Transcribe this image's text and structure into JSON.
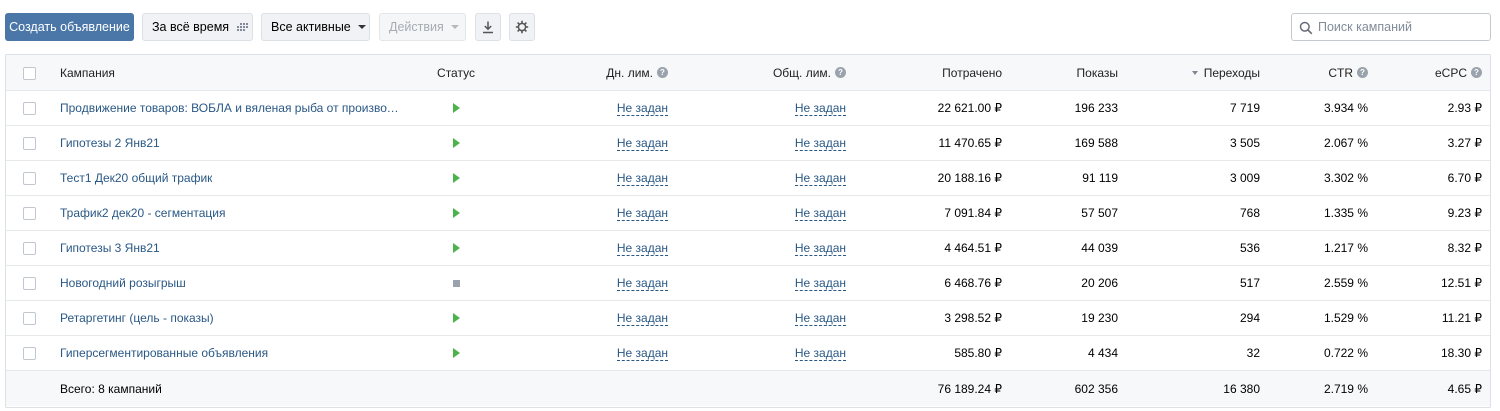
{
  "toolbar": {
    "create_label": "Создать объявление",
    "period_label": "За всё время",
    "filter_label": "Все активные",
    "actions_label": "Действия",
    "download_icon": "download-icon",
    "settings_icon": "gear-icon"
  },
  "search": {
    "placeholder": "Поиск кампаний",
    "value": ""
  },
  "table": {
    "headers": {
      "campaign": "Кампания",
      "status": "Статус",
      "day_limit": "Дн. лим.",
      "total_limit": "Общ. лим.",
      "spent": "Потрачено",
      "shows": "Показы",
      "clicks": "Переходы",
      "ctr": "CTR",
      "ecpc": "eCPC"
    },
    "sorted_column": "clicks",
    "rows": [
      {
        "name": "Продвижение товаров: ВОБЛА и вяленая рыба от производит...",
        "status": "play",
        "day_limit": "Не задан",
        "total_limit": "Не задан",
        "spent": "22 621.00 ₽",
        "shows": "196 233",
        "clicks": "7 719",
        "ctr": "3.934 %",
        "ecpc": "2.93 ₽"
      },
      {
        "name": "Гипотезы 2 Янв21",
        "status": "play",
        "day_limit": "Не задан",
        "total_limit": "Не задан",
        "spent": "11 470.65 ₽",
        "shows": "169 588",
        "clicks": "3 505",
        "ctr": "2.067 %",
        "ecpc": "3.27 ₽"
      },
      {
        "name": "Тест1 Дек20 общий трафик",
        "status": "play",
        "day_limit": "Не задан",
        "total_limit": "Не задан",
        "spent": "20 188.16 ₽",
        "shows": "91 119",
        "clicks": "3 009",
        "ctr": "3.302 %",
        "ecpc": "6.70 ₽"
      },
      {
        "name": "Трафик2 дек20 - сегментация",
        "status": "play",
        "day_limit": "Не задан",
        "total_limit": "Не задан",
        "spent": "7 091.84 ₽",
        "shows": "57 507",
        "clicks": "768",
        "ctr": "1.335 %",
        "ecpc": "9.23 ₽"
      },
      {
        "name": "Гипотезы 3 Янв21",
        "status": "play",
        "day_limit": "Не задан",
        "total_limit": "Не задан",
        "spent": "4 464.51 ₽",
        "shows": "44 039",
        "clicks": "536",
        "ctr": "1.217 %",
        "ecpc": "8.32 ₽"
      },
      {
        "name": "Новогодний розыгрыш",
        "status": "stop",
        "day_limit": "Не задан",
        "total_limit": "Не задан",
        "spent": "6 468.76 ₽",
        "shows": "20 206",
        "clicks": "517",
        "ctr": "2.559 %",
        "ecpc": "12.51 ₽"
      },
      {
        "name": "Ретаргетинг (цель - показы)",
        "status": "play",
        "day_limit": "Не задан",
        "total_limit": "Не задан",
        "spent": "3 298.52 ₽",
        "shows": "19 230",
        "clicks": "294",
        "ctr": "1.529 %",
        "ecpc": "11.21 ₽"
      },
      {
        "name": "Гиперсегментированные объявления",
        "status": "play",
        "day_limit": "Не задан",
        "total_limit": "Не задан",
        "spent": "585.80 ₽",
        "shows": "4 434",
        "clicks": "32",
        "ctr": "0.722 %",
        "ecpc": "18.30 ₽"
      }
    ],
    "footer": {
      "label": "Всего: 8 кампаний",
      "spent": "76 189.24 ₽",
      "shows": "602 356",
      "clicks": "16 380",
      "ctr": "2.719 %",
      "ecpc": "4.65 ₽"
    }
  },
  "colors": {
    "primary": "#4a76a8",
    "link": "#2a5885",
    "status_active": "#4bb34b",
    "status_stopped": "#99a2ad"
  }
}
